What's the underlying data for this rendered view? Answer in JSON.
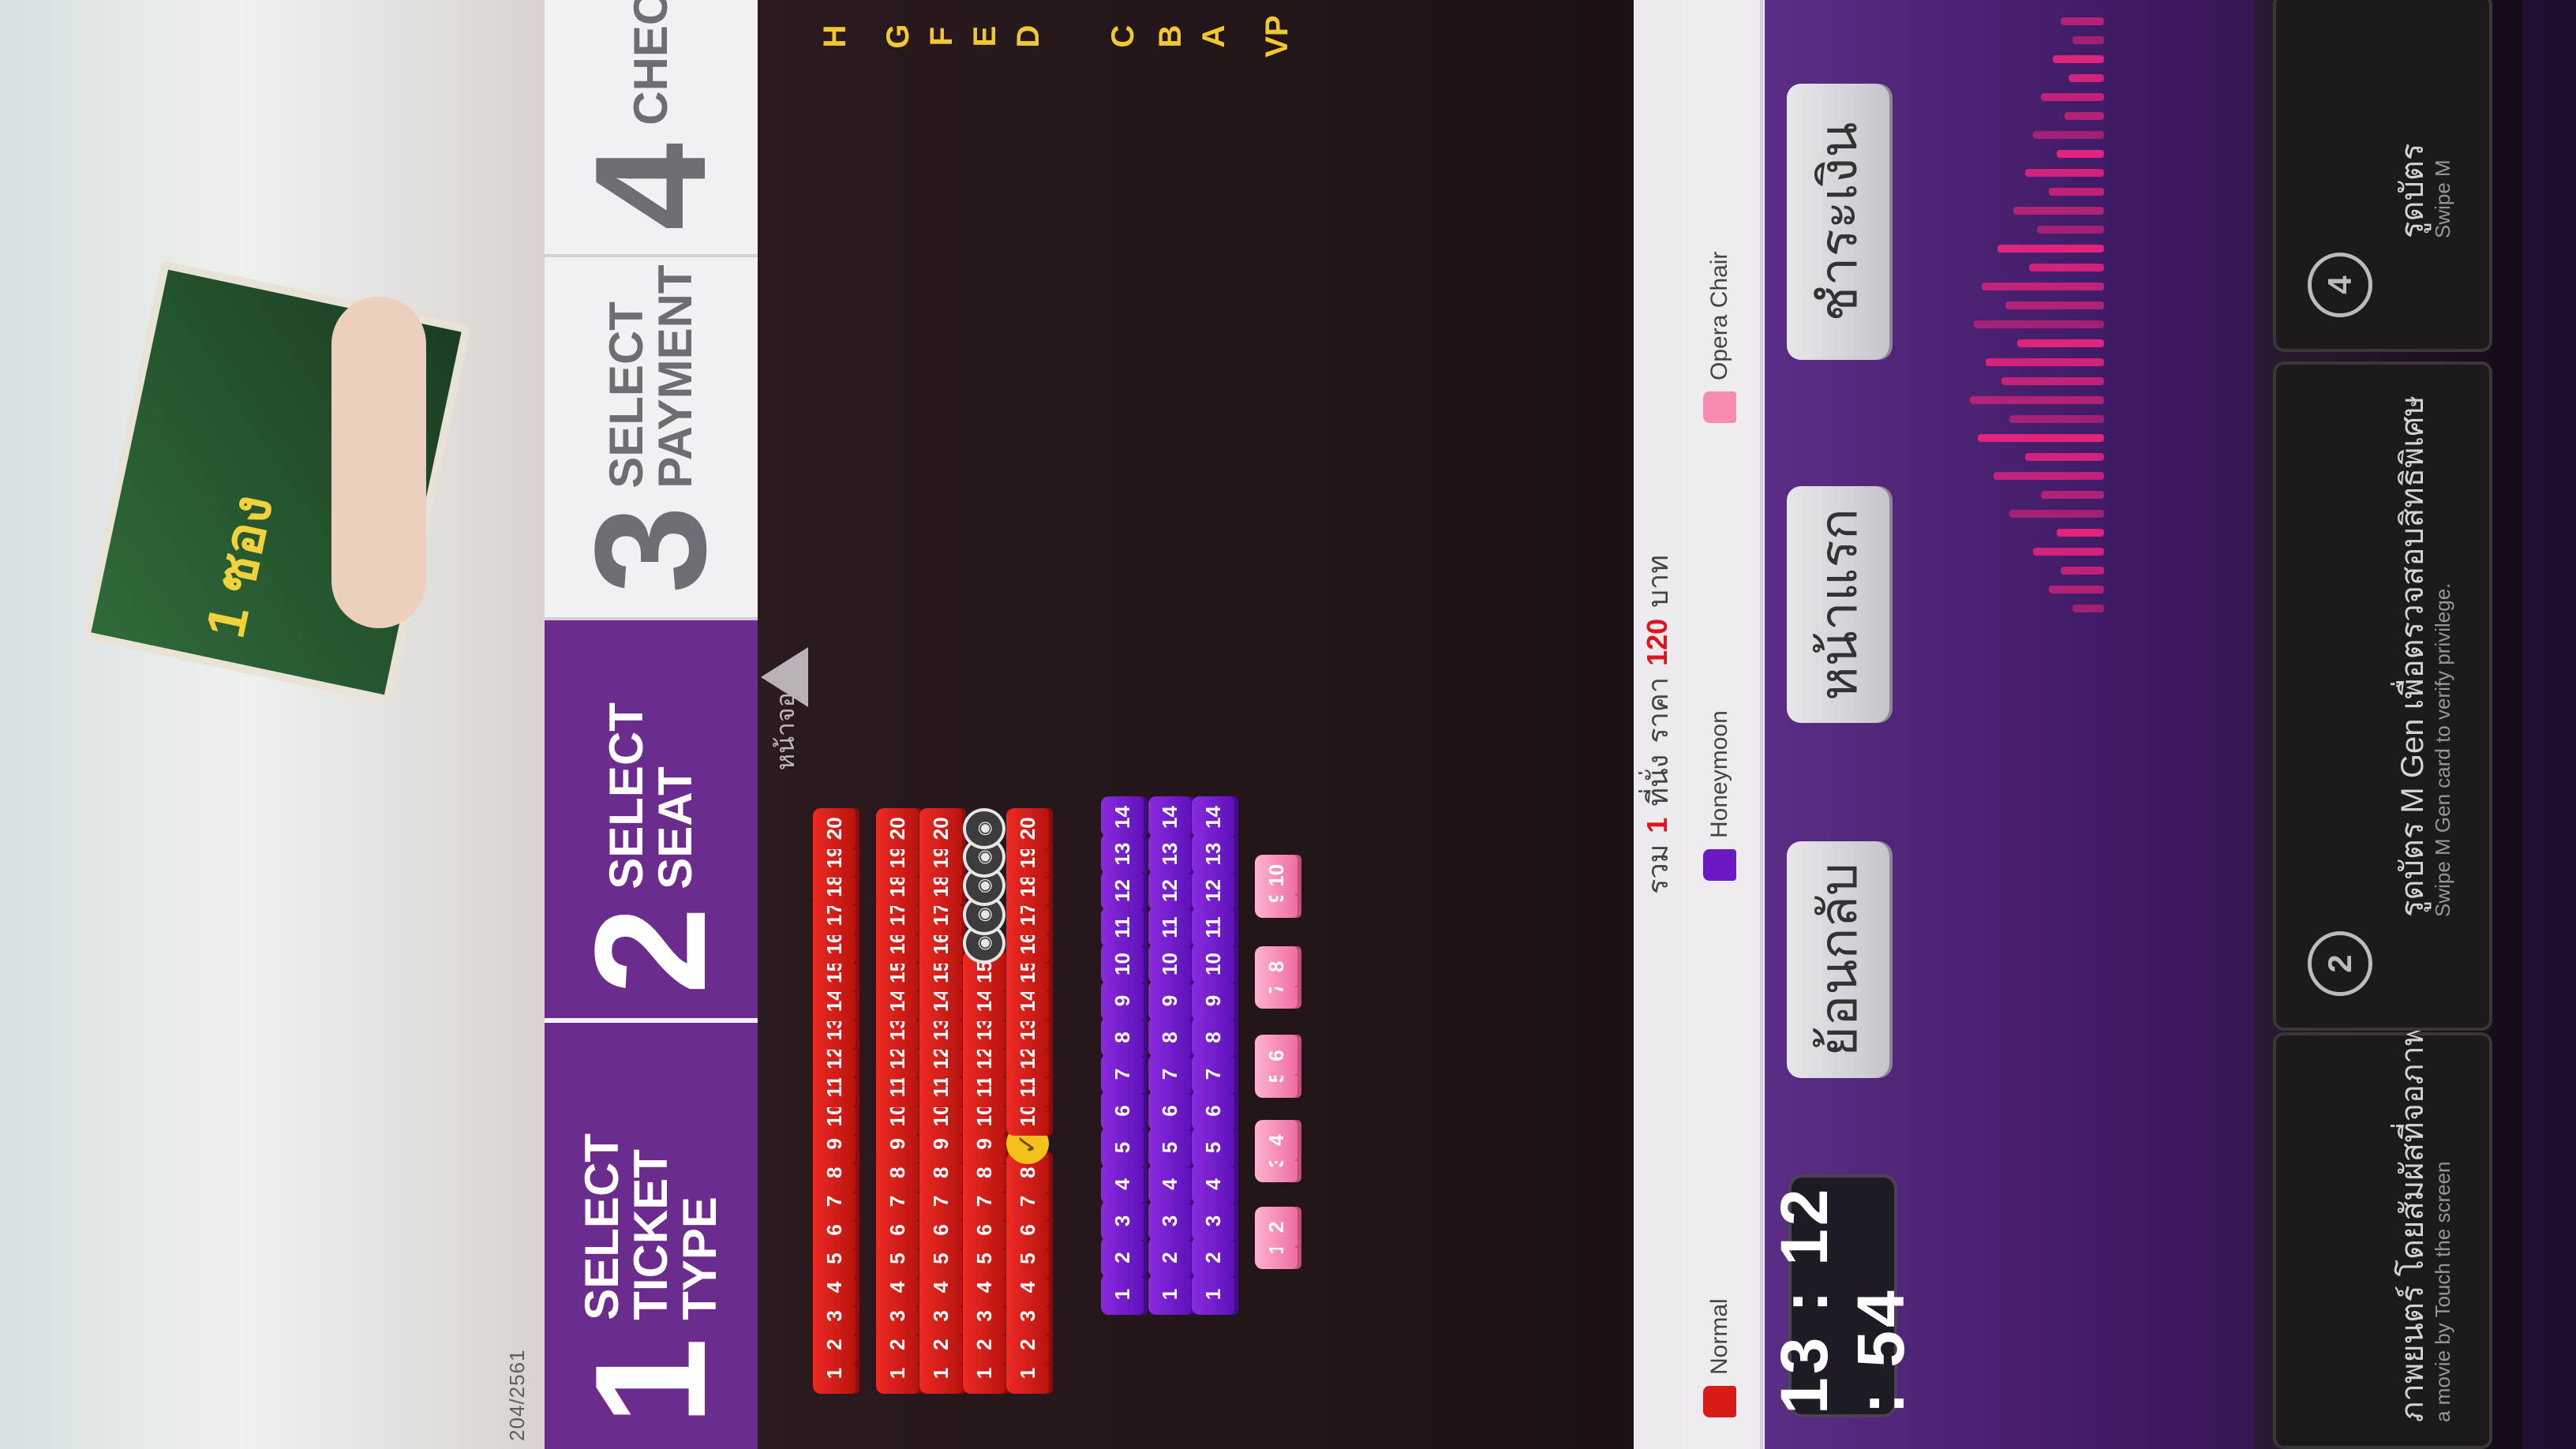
{
  "advert": {
    "product_text": "1 ซอง"
  },
  "footer_date": "204/2561",
  "steps": [
    {
      "number": "1",
      "label_line1": "SELECT",
      "label_line2": "TICKET TYPE"
    },
    {
      "number": "2",
      "label_line1": "SELECT SEAT",
      "label_line2": ""
    },
    {
      "number": "3",
      "label_line1": "SELECT",
      "label_line2": "PAYMENT"
    },
    {
      "number": "4",
      "label_line1": "CHEC",
      "label_line2": ""
    }
  ],
  "screen_label": "หน้าจอ",
  "seat_rows": [
    {
      "row": "H",
      "type": "normal",
      "seats": [
        "1",
        "2",
        "3",
        "4",
        "5",
        "6",
        "7",
        "8",
        "9",
        "10",
        "11",
        "12",
        "13",
        "14",
        "15",
        "16",
        "17",
        "18",
        "19",
        "20"
      ]
    },
    {
      "row": "G",
      "type": "normal",
      "seats": [
        "1",
        "2",
        "3",
        "4",
        "5",
        "6",
        "7",
        "8",
        "9",
        "10",
        "11",
        "12",
        "13",
        "14",
        "15",
        "16",
        "17",
        "18",
        "19",
        "20"
      ]
    },
    {
      "row": "F",
      "type": "normal",
      "seats": [
        "1",
        "2",
        "3",
        "4",
        "5",
        "6",
        "7",
        "8",
        "9",
        "10",
        "11",
        "12",
        "13",
        "14",
        "15",
        "16",
        "17",
        "18",
        "19",
        "20"
      ]
    },
    {
      "row": "E",
      "type": "normal",
      "seats": [
        "1",
        "2",
        "3",
        "4",
        "5",
        "6",
        "7",
        "8",
        "9",
        "10",
        "11",
        "12",
        "13",
        "14",
        "15",
        "16",
        "17",
        "18",
        "19",
        "20"
      ],
      "taken": [
        "16",
        "17",
        "18",
        "19",
        "20"
      ]
    },
    {
      "row": "D",
      "type": "normal",
      "seats": [
        "1",
        "2",
        "3",
        "4",
        "5",
        "6",
        "7",
        "8",
        "9",
        "10",
        "11",
        "12",
        "13",
        "14",
        "15",
        "16",
        "17",
        "18",
        "19",
        "20"
      ],
      "selected": [
        "9"
      ]
    },
    {
      "row": "C",
      "type": "honeymoon",
      "seats": [
        "1",
        "2",
        "3",
        "4",
        "5",
        "6",
        "7",
        "8",
        "9",
        "10",
        "11",
        "12",
        "13",
        "14"
      ]
    },
    {
      "row": "B",
      "type": "honeymoon",
      "seats": [
        "1",
        "2",
        "3",
        "4",
        "5",
        "6",
        "7",
        "8",
        "9",
        "10",
        "11",
        "12",
        "13",
        "14"
      ]
    },
    {
      "row": "A",
      "type": "honeymoon",
      "seats": [
        "1",
        "2",
        "3",
        "4",
        "5",
        "6",
        "7",
        "8",
        "9",
        "10",
        "11",
        "12",
        "13",
        "14"
      ]
    },
    {
      "row": "VP",
      "type": "opera",
      "seats": [
        "1",
        "2",
        "3",
        "4",
        "5",
        "6",
        "7",
        "8",
        "9",
        "10"
      ]
    }
  ],
  "selected_mark": "✓",
  "taken_mark": "◉",
  "summary": {
    "prefix": "รวม",
    "count": "1",
    "seat_word": "ที่นั่ง",
    "price_word": "ราคา",
    "price": "120",
    "currency": "บาท"
  },
  "legend": [
    {
      "label": "Normal",
      "color": "#d81b17"
    },
    {
      "label": "Honeymoon",
      "color": "#6a19c4"
    },
    {
      "label": "Opera Chair",
      "color": "#f58bb2"
    }
  ],
  "timer": "13 : 12 : 54",
  "buttons": {
    "back": "ย้อนกลับ",
    "home": "หน้าแรก",
    "pay": "ชำระเงิน"
  },
  "promos": [
    {
      "number": "",
      "title": "ภาพยนตร์ โดยสัมผัสที่จอภาพ",
      "subtitle": "a movie by Touch the screen"
    },
    {
      "number": "2",
      "title": "รูดบัตร M Gen เพื่อตรวจสอบสิทธิพิเศษ",
      "subtitle": "Swipe M Gen card to verify privilege."
    },
    {
      "number": "4",
      "title": "รูดบัตร",
      "subtitle": "Swipe M"
    }
  ],
  "colors": {
    "accent": "#6c2c8d",
    "normal": "#d81b17",
    "honeymoon": "#6a19c4",
    "opera": "#f58bb2",
    "selected": "#f2c21a"
  }
}
